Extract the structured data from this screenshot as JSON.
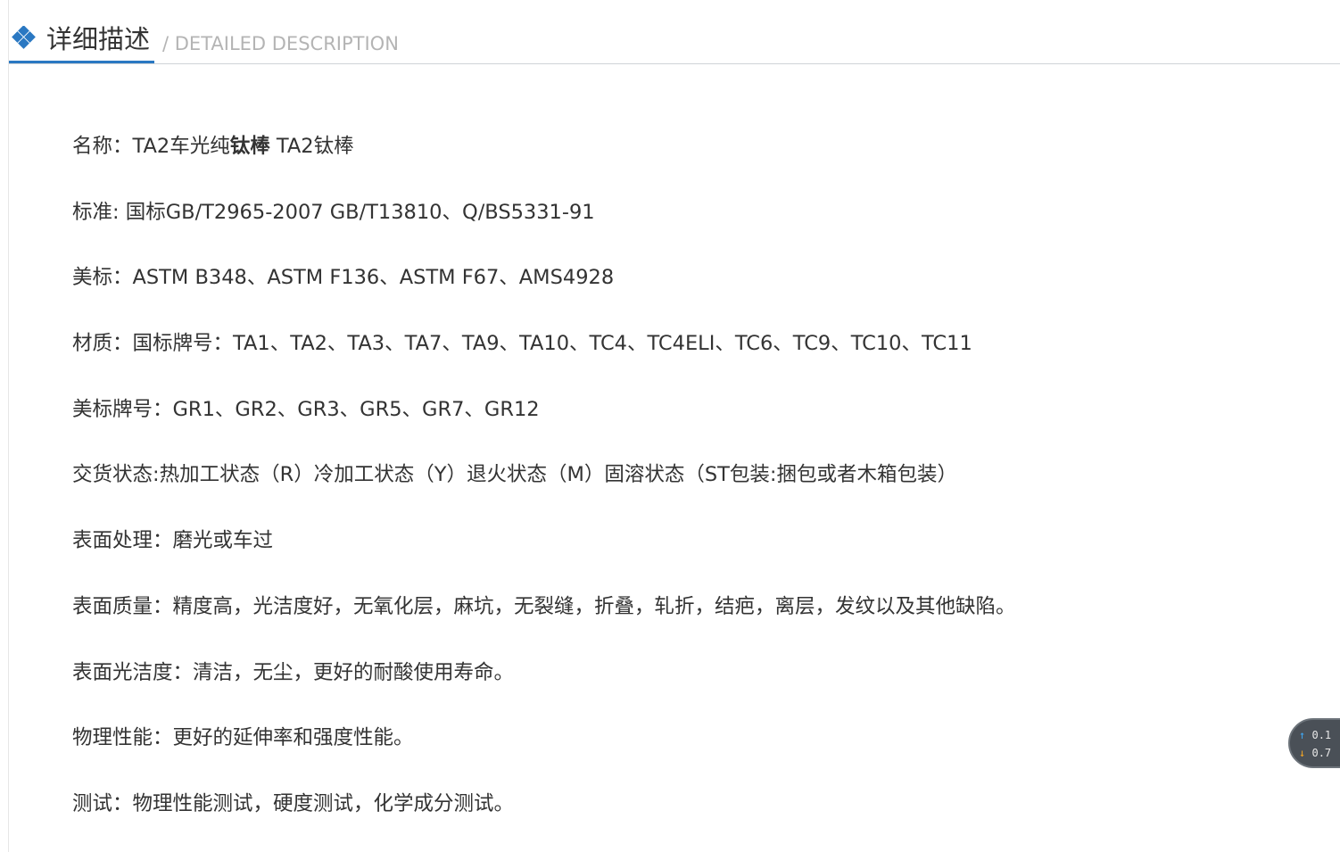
{
  "header": {
    "title_cn": "详细描述",
    "title_en": "/ DETAILED DESCRIPTION",
    "icon": "diamond-grid-icon",
    "accent_color": "#2a78c2"
  },
  "lines": [
    {
      "prefix": "名称：TA2车光纯",
      "bold": "钛棒",
      "suffix": " TA2钛棒"
    },
    {
      "prefix": "标准: 国标GB/T2965-2007 GB/T13810、Q/BS5331-91",
      "bold": "",
      "suffix": ""
    },
    {
      "prefix": "美标：ASTM B348、ASTM F136、ASTM F67、AMS4928",
      "bold": "",
      "suffix": ""
    },
    {
      "prefix": "材质：国标牌号：TA1、TA2、TA3、TA7、TA9、TA10、TC4、TC4ELI、TC6、TC9、TC10、TC11",
      "bold": "",
      "suffix": ""
    },
    {
      "prefix": "美标牌号：GR1、GR2、GR3、GR5、GR7、GR12",
      "bold": "",
      "suffix": ""
    },
    {
      "prefix": "交货状态:热加工状态（R）冷加工状态（Y）退火状态（M）固溶状态（ST包装:捆包或者木箱包装）",
      "bold": "",
      "suffix": ""
    },
    {
      "prefix": "表面处理：磨光或车过",
      "bold": "",
      "suffix": ""
    },
    {
      "prefix": "表面质量：精度高，光洁度好，无氧化层，麻坑，无裂缝，折叠，轧折，结疤，离层，发纹以及其他缺陷。",
      "bold": "",
      "suffix": ""
    },
    {
      "prefix": "表面光洁度：清洁，无尘，更好的耐酸使用寿命。",
      "bold": "",
      "suffix": ""
    },
    {
      "prefix": "物理性能：更好的延伸率和强度性能。",
      "bold": "",
      "suffix": ""
    },
    {
      "prefix": "测试：物理性能测试，硬度测试，化学成分测试。",
      "bold": "",
      "suffix": ""
    }
  ],
  "speed_widget": {
    "up_icon": "arrow-up-icon",
    "down_icon": "arrow-down-icon",
    "up_value": "0.1",
    "down_value": "0.7"
  }
}
